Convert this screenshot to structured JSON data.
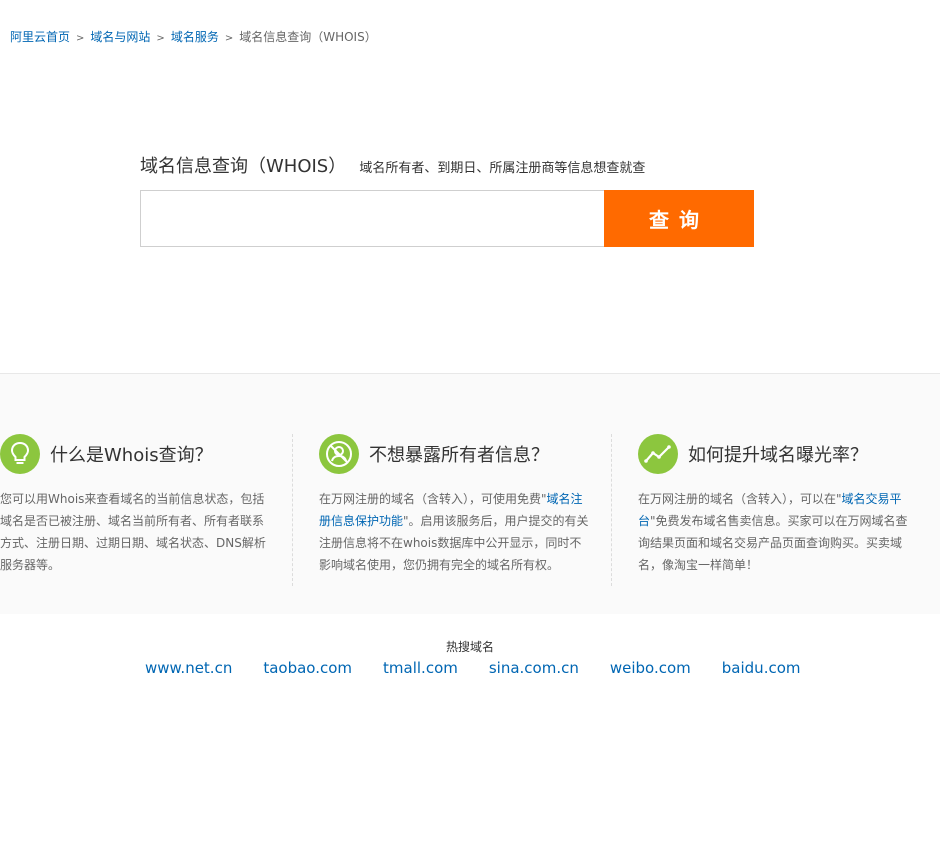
{
  "breadcrumb": {
    "home": "阿里云首页",
    "domains": "域名与网站",
    "services": "域名服务",
    "current": "域名信息查询（WHOIS）",
    "separator": ">"
  },
  "search": {
    "title": "域名信息查询（WHOIS）",
    "subtitle": "域名所有者、到期日、所属注册商等信息想查就查",
    "placeholder": "",
    "value": "",
    "button_label": "查询"
  },
  "info": [
    {
      "icon": "lightbulb-icon",
      "title": "什么是Whois查询？",
      "text": "您可以用Whois来查看域名的当前信息状态，包括域名是否已被注册、域名当前所有者、所有者联系方式、注册日期、过期日期、域名状态、DNS解析服务器等。"
    },
    {
      "icon": "privacy-icon",
      "title": "不想暴露所有者信息？",
      "text_before": "在万网注册的域名（含转入），可使用免费\"",
      "link": "域名注册信息保护功能",
      "text_after": "\"。启用该服务后，用户提交的有关注册信息将不在whois数据库中公开显示，同时不影响域名使用，您仍拥有完全的域名所有权。"
    },
    {
      "icon": "trend-icon",
      "title": "如何提升域名曝光率？",
      "text_before": "在万网注册的域名（含转入），可以在\"",
      "link": "域名交易平台",
      "text_after": "\"免费发布域名售卖信息。买家可以在万网域名查询结果页面和域名交易产品页面查询购买。买卖域名，像淘宝一样简单！"
    }
  ],
  "hot": {
    "label": "热搜域名",
    "domains": [
      "www.net.cn",
      "taobao.com",
      "tmall.com",
      "sina.com.cn",
      "weibo.com",
      "baidu.com"
    ]
  },
  "colors": {
    "accent": "#ff6a00",
    "link": "#0066b3",
    "icon_green": "#8cc63e"
  }
}
